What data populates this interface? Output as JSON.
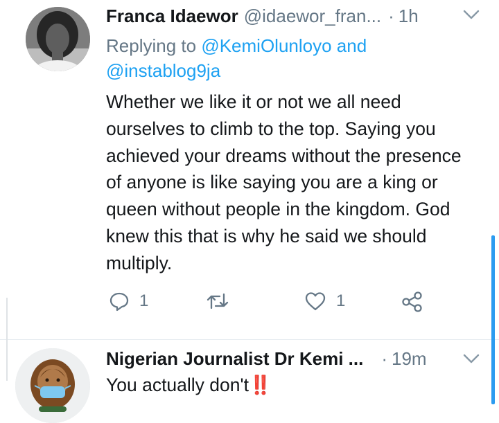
{
  "tweet1": {
    "name": "Franca Idaewor",
    "handle": "@idaewor_fran...",
    "dot": "·",
    "time": "1h",
    "replying_prefix": "Replying to",
    "mention1": "@KemiOlunloyo",
    "and": "and",
    "mention2": "@instablog9ja",
    "text": "Whether we like it or not we all need ourselves to climb to the top. Saying you achieved your dreams without the presence of anyone is like saying you are a king or queen without people in the kingdom. God knew this that is why he said we should multiply.",
    "reply_count": "1",
    "like_count": "1",
    "icons": [
      "reply-icon",
      "retweet-icon",
      "like-icon",
      "share-icon",
      "chevron-down-icon"
    ]
  },
  "tweet2": {
    "name": "Nigerian Journalist Dr Kemi ...",
    "dot": "·",
    "time": "19m",
    "text": "You actually don't",
    "emoji": "‼️"
  },
  "colors": {
    "accent": "#1da1f2",
    "muted": "#657786",
    "text": "#14171a",
    "scroll": "#2b9bf0"
  }
}
